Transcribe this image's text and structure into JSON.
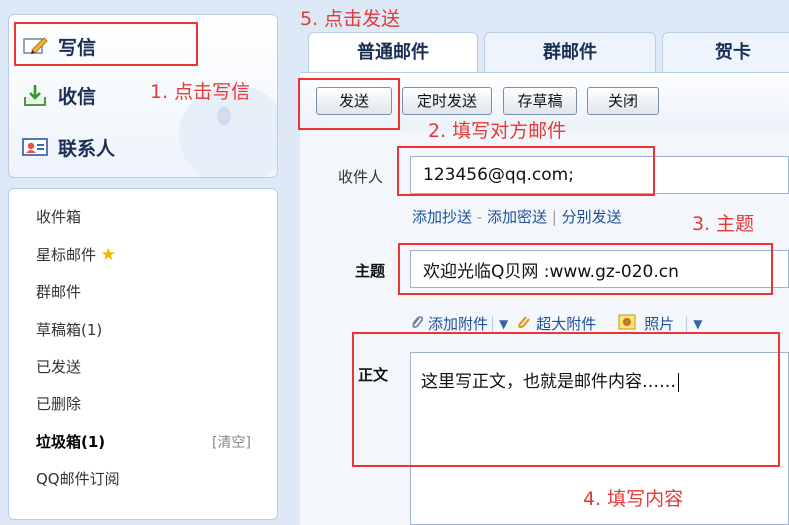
{
  "sidebar": {
    "write_label": "写信",
    "inbox_label": "收信",
    "contacts_label": "联系人",
    "folders": [
      {
        "label": "收件箱",
        "bold": false
      },
      {
        "label": "星标邮件 ",
        "bold": false,
        "star": true
      },
      {
        "label": "群邮件",
        "bold": false
      },
      {
        "label": "草稿箱(1)",
        "bold": false
      },
      {
        "label": "已发送",
        "bold": false
      },
      {
        "label": "已删除",
        "bold": false
      },
      {
        "label": "垃圾箱(1)",
        "bold": true
      },
      {
        "label": "QQ邮件订阅",
        "bold": false
      }
    ],
    "clear_label": "[清空]"
  },
  "tabs": [
    "普通邮件",
    "群邮件",
    "贺卡"
  ],
  "toolbar": {
    "send": "发送",
    "scheduled_send": "定时发送",
    "save_draft": "存草稿",
    "close": "关闭"
  },
  "form": {
    "recipient_label": "收件人",
    "recipient_value": "123456@qq.com;",
    "add_cc": "添加抄送",
    "dash": " - ",
    "add_bcc": "添加密送",
    "pipe": " | ",
    "send_separately": "分别发送",
    "subject_label": "主题",
    "subject_value": "欢迎光临Q贝网 :www.gz-020.cn",
    "add_attachment": "添加附件",
    "large_attachment": "超大附件",
    "photo": "照片",
    "body_label": "正文",
    "body_value": "这里写正文，也就是邮件内容……"
  },
  "annotations": {
    "step1": "1. 点击写信",
    "step2": "2. 填写对方邮件",
    "step3": "3. 主题",
    "step4": "4. 填写内容",
    "step5": "5. 点击发送"
  },
  "colors": {
    "annotation_red": "#e53935",
    "accent_blue": "#1f4f9a",
    "star_yellow": "#f5b400"
  },
  "icons": [
    "pencil-icon",
    "inbox-tray-icon",
    "contact-card-icon",
    "star-icon",
    "paperclip-icon",
    "dropdown-arrow-icon",
    "large-attachment-icon",
    "photo-icon"
  ]
}
